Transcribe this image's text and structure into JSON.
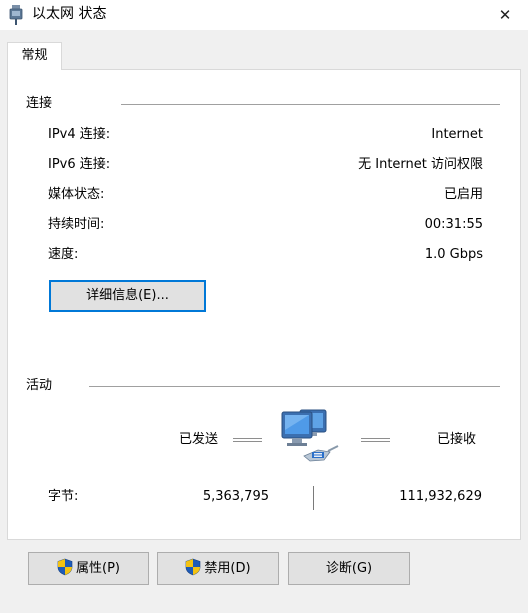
{
  "window": {
    "title": "以太网 状态",
    "close_glyph": "✕"
  },
  "tabs": [
    {
      "label": "常规"
    }
  ],
  "connection": {
    "group_label": "连接",
    "rows": [
      {
        "label": "IPv4 连接:",
        "value": "Internet"
      },
      {
        "label": "IPv6 连接:",
        "value": "无 Internet 访问权限"
      },
      {
        "label": "媒体状态:",
        "value": "已启用"
      },
      {
        "label": "持续时间:",
        "value": "00:31:55"
      },
      {
        "label": "速度:",
        "value": "1.0 Gbps"
      }
    ],
    "details_button": "详细信息(E)..."
  },
  "activity": {
    "group_label": "活动",
    "sent_label": "已发送",
    "received_label": "已接收",
    "bytes_label": "字节:",
    "bytes_sent": "5,363,795",
    "bytes_received": "111,932,629",
    "icon": "network-computers-icon"
  },
  "buttons": {
    "properties": "属性(P)",
    "disable": "禁用(D)",
    "diagnose": "诊断(G)"
  },
  "colors": {
    "focus_border": "#0078d7",
    "shield_blue": "#1e5bb8",
    "shield_yellow": "#f3c212"
  }
}
